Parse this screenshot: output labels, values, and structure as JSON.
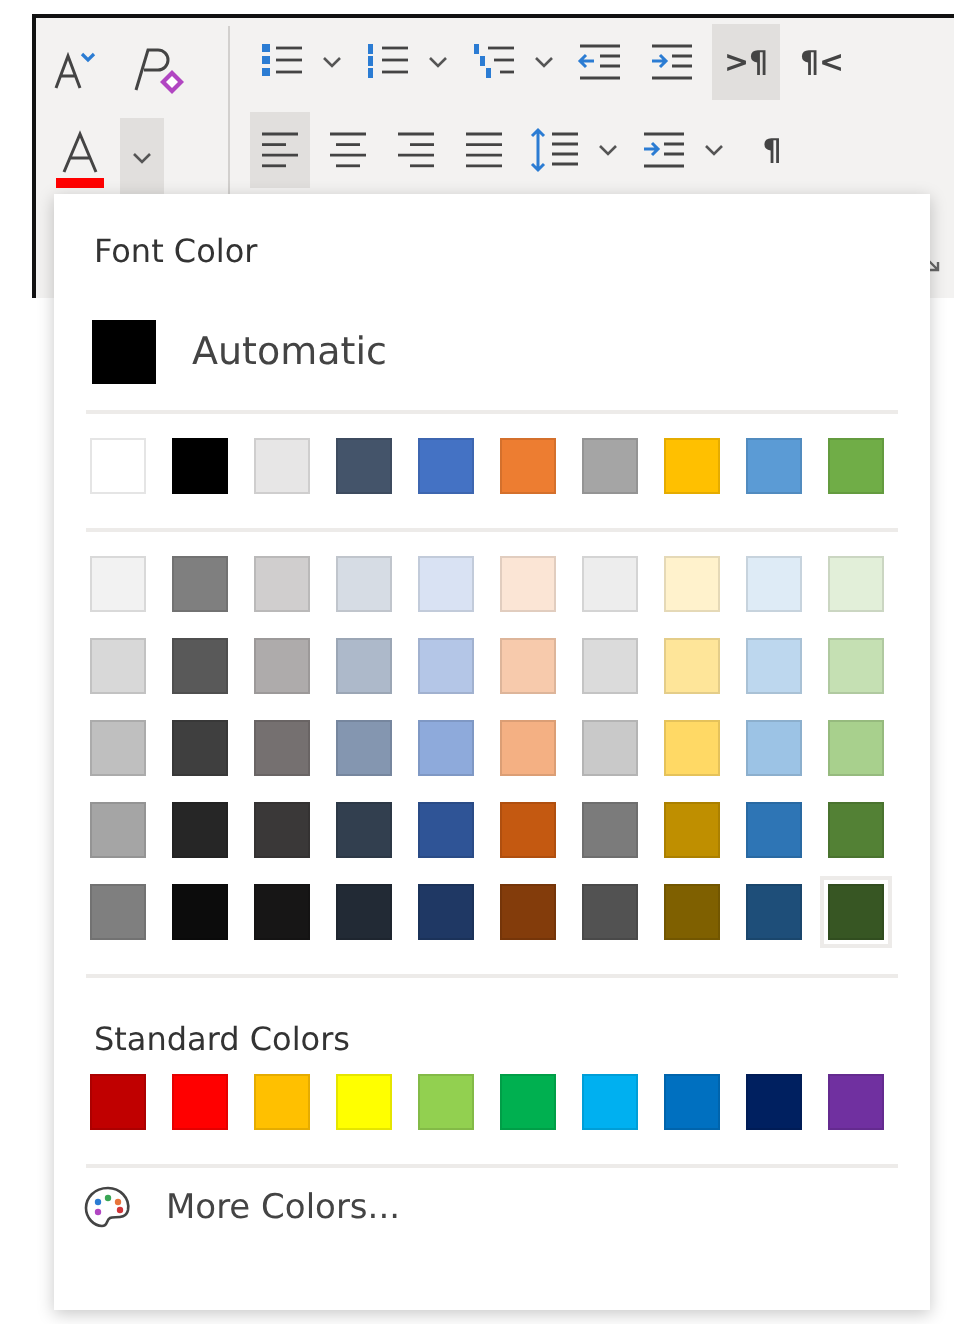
{
  "ribbon": {
    "row_1": [
      {
        "kind": "grow-font",
        "selected": false
      },
      {
        "kind": "clear-format",
        "selected": false
      },
      {
        "kind": "bullets",
        "selected": false
      },
      {
        "kind": "caret",
        "selected": false
      },
      {
        "kind": "numbering",
        "selected": false
      },
      {
        "kind": "caret",
        "selected": false
      },
      {
        "kind": "multilevel",
        "selected": false
      },
      {
        "kind": "caret",
        "selected": false
      },
      {
        "kind": "outdent",
        "selected": false
      },
      {
        "kind": "indent",
        "selected": false
      },
      {
        "kind": "glyph",
        "glyph": ">¶",
        "selected": true
      },
      {
        "kind": "glyph",
        "glyph": "¶<",
        "selected": false
      }
    ],
    "font_color": {
      "color": "#ff0000",
      "expanded": true
    },
    "row_2": [
      {
        "kind": "align-left",
        "selected": true
      },
      {
        "kind": "align-center",
        "selected": false
      },
      {
        "kind": "align-right",
        "selected": false
      },
      {
        "kind": "justify",
        "selected": false
      },
      {
        "kind": "line-spacing",
        "selected": false
      },
      {
        "kind": "caret",
        "selected": false
      },
      {
        "kind": "indent",
        "selected": false
      },
      {
        "kind": "caret",
        "selected": false
      },
      {
        "kind": "glyph",
        "glyph": "¶",
        "selected": false
      }
    ]
  },
  "dropdown": {
    "title": "Font Color",
    "automatic": {
      "label": "Automatic",
      "color": "#000000"
    },
    "theme_top": [
      {
        "color": "#ffffff",
        "selected": false
      },
      {
        "color": "#000000",
        "selected": false
      },
      {
        "color": "#e7e6e6",
        "selected": false
      },
      {
        "color": "#44546a",
        "selected": false
      },
      {
        "color": "#4472c4",
        "selected": false
      },
      {
        "color": "#ed7d31",
        "selected": false
      },
      {
        "color": "#a5a5a5",
        "selected": false
      },
      {
        "color": "#ffc000",
        "selected": false
      },
      {
        "color": "#5b9bd5",
        "selected": false
      },
      {
        "color": "#70ad47",
        "selected": false
      }
    ],
    "theme_shades": [
      [
        {
          "color": "#f2f2f2",
          "selected": false
        },
        {
          "color": "#7f7f7f",
          "selected": false
        },
        {
          "color": "#d0cece",
          "selected": false
        },
        {
          "color": "#d6dce4",
          "selected": false
        },
        {
          "color": "#d9e2f3",
          "selected": false
        },
        {
          "color": "#fbe5d5",
          "selected": false
        },
        {
          "color": "#ededed",
          "selected": false
        },
        {
          "color": "#fff2cc",
          "selected": false
        },
        {
          "color": "#deebf6",
          "selected": false
        },
        {
          "color": "#e2efd9",
          "selected": false
        }
      ],
      [
        {
          "color": "#d8d8d8",
          "selected": false
        },
        {
          "color": "#595959",
          "selected": false
        },
        {
          "color": "#aeabab",
          "selected": false
        },
        {
          "color": "#adb9ca",
          "selected": false
        },
        {
          "color": "#b4c6e7",
          "selected": false
        },
        {
          "color": "#f7caac",
          "selected": false
        },
        {
          "color": "#dbdbdb",
          "selected": false
        },
        {
          "color": "#fee599",
          "selected": false
        },
        {
          "color": "#bdd7ee",
          "selected": false
        },
        {
          "color": "#c5e0b3",
          "selected": false
        }
      ],
      [
        {
          "color": "#bfbfbf",
          "selected": false
        },
        {
          "color": "#3f3f3f",
          "selected": false
        },
        {
          "color": "#757070",
          "selected": false
        },
        {
          "color": "#8496b0",
          "selected": false
        },
        {
          "color": "#8eaadb",
          "selected": false
        },
        {
          "color": "#f4b083",
          "selected": false
        },
        {
          "color": "#c9c9c9",
          "selected": false
        },
        {
          "color": "#ffd965",
          "selected": false
        },
        {
          "color": "#9cc3e5",
          "selected": false
        },
        {
          "color": "#a8d08d",
          "selected": false
        }
      ],
      [
        {
          "color": "#a5a5a5",
          "selected": false
        },
        {
          "color": "#262626",
          "selected": false
        },
        {
          "color": "#3a3838",
          "selected": false
        },
        {
          "color": "#323f4f",
          "selected": false
        },
        {
          "color": "#2f5496",
          "selected": false
        },
        {
          "color": "#c45911",
          "selected": false
        },
        {
          "color": "#7b7b7b",
          "selected": false
        },
        {
          "color": "#bf8f00",
          "selected": false
        },
        {
          "color": "#2e75b5",
          "selected": false
        },
        {
          "color": "#538135",
          "selected": false
        }
      ],
      [
        {
          "color": "#7f7f7f",
          "selected": false
        },
        {
          "color": "#0c0c0c",
          "selected": false
        },
        {
          "color": "#171616",
          "selected": false
        },
        {
          "color": "#222a35",
          "selected": false
        },
        {
          "color": "#1f3864",
          "selected": false
        },
        {
          "color": "#833c0b",
          "selected": false
        },
        {
          "color": "#525252",
          "selected": false
        },
        {
          "color": "#7f6000",
          "selected": false
        },
        {
          "color": "#1e4e79",
          "selected": false
        },
        {
          "color": "#375623",
          "selected": true
        }
      ]
    ],
    "standard_title": "Standard Colors",
    "standard": [
      {
        "color": "#c00000",
        "selected": false
      },
      {
        "color": "#ff0000",
        "selected": false
      },
      {
        "color": "#ffc000",
        "selected": false
      },
      {
        "color": "#ffff00",
        "selected": false
      },
      {
        "color": "#92d050",
        "selected": false
      },
      {
        "color": "#00b050",
        "selected": false
      },
      {
        "color": "#00b0f0",
        "selected": false
      },
      {
        "color": "#0070c0",
        "selected": false
      },
      {
        "color": "#002060",
        "selected": false
      },
      {
        "color": "#7030a0",
        "selected": false
      }
    ],
    "more_colors": "More Colors..."
  }
}
